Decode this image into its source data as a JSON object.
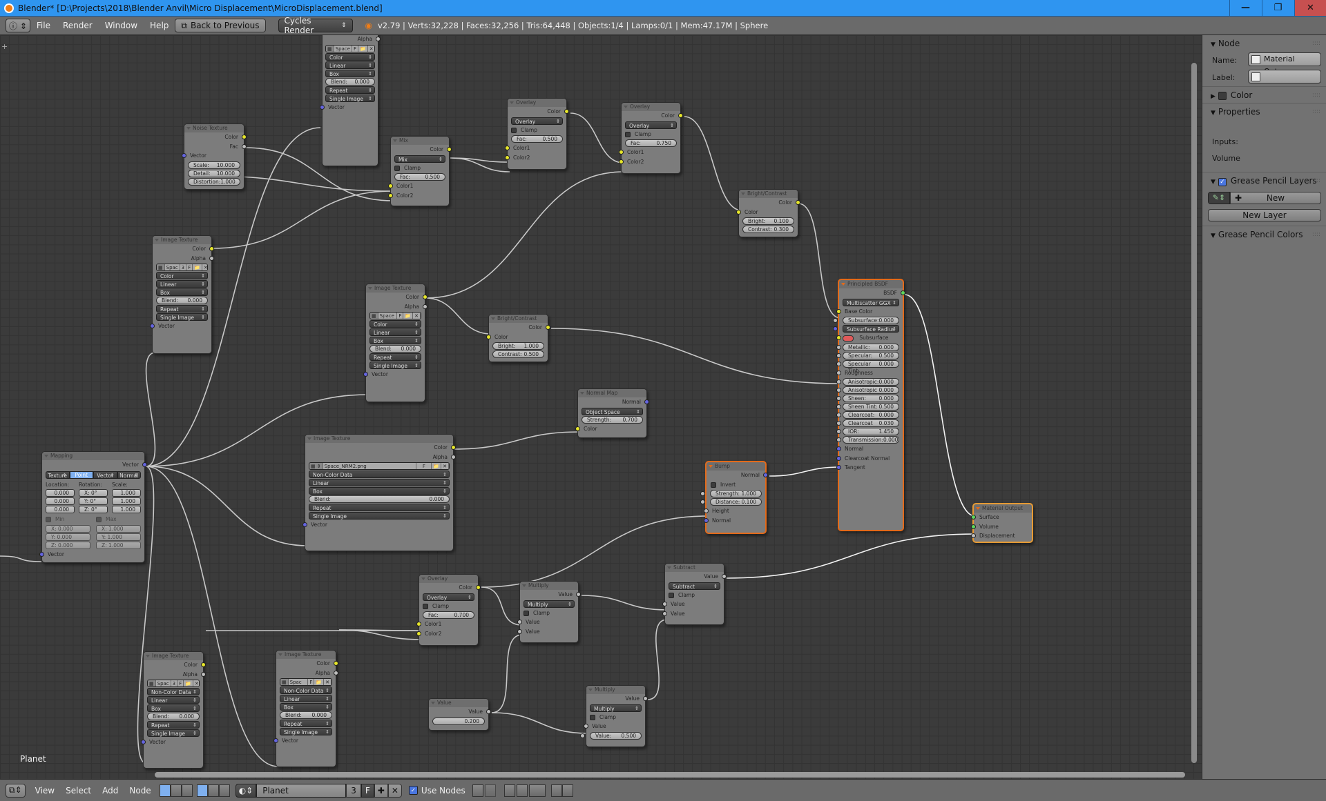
{
  "window": {
    "title": "Blender* [D:\\Projects\\2018\\Blender Anvil\\Micro Displacement\\MicroDisplacement.blend]",
    "minimize": "—",
    "restore": "❐",
    "close": "✕"
  },
  "menubar": {
    "items": [
      "File",
      "Render",
      "Window",
      "Help"
    ],
    "back_button": "Back to Previous",
    "render_engine": "Cycles Render",
    "stats": "v2.79 | Verts:32,228 | Faces:32,256 | Tris:64,448 | Objects:1/4 | Lamps:0/1 | Mem:47.17M | Sphere"
  },
  "canvas": {
    "material_label": "Planet"
  },
  "nodes": {
    "imgtex_top": {
      "alpha": "Alpha",
      "image": "Space",
      "f": "F",
      "colorspace": "Color",
      "interp": "Linear",
      "proj": "Box",
      "blend_label": "Blend:",
      "blend": "0.000",
      "ext": "Repeat",
      "source": "Single Image",
      "vector": "Vector"
    },
    "noise": {
      "title": "Noise Texture",
      "color": "Color",
      "fac": "Fac",
      "vector": "Vector",
      "scale_label": "Scale:",
      "scale": "10.000",
      "detail_label": "Detail:",
      "detail": "10.000",
      "distortion_label": "Distortion:",
      "distortion": "1.000"
    },
    "mix": {
      "title": "Mix",
      "color": "Color",
      "mode": "Mix",
      "clamp": "Clamp",
      "fac_label": "Fac:",
      "fac": "0.500",
      "c1": "Color1",
      "c2": "Color2"
    },
    "overlay1": {
      "title": "Overlay",
      "color": "Color",
      "mode": "Overlay",
      "clamp": "Clamp",
      "fac_label": "Fac:",
      "fac": "0.500",
      "c1": "Color1",
      "c2": "Color2"
    },
    "overlay2": {
      "title": "Overlay",
      "color": "Color",
      "mode": "Overlay",
      "clamp": "Clamp",
      "fac_label": "Fac:",
      "fac": "0.750",
      "c1": "Color1",
      "c2": "Color2"
    },
    "bc1": {
      "title": "Bright/Contrast",
      "color_out": "Color",
      "color_in": "Color",
      "bright_label": "Bright:",
      "bright": "0.100",
      "contrast_label": "Contrast:",
      "contrast": "0.300"
    },
    "imgtex_left": {
      "title": "Image Texture",
      "color": "Color",
      "alpha": "Alpha",
      "image": "Spac",
      "users": "3",
      "f": "F",
      "colorspace": "Color",
      "interp": "Linear",
      "proj": "Box",
      "blend_label": "Blend:",
      "blend": "0.000",
      "ext": "Repeat",
      "source": "Single Image",
      "vector": "Vector"
    },
    "imgtex_mid": {
      "title": "Image Texture",
      "color": "Color",
      "alpha": "Alpha",
      "image": "Space",
      "f": "F",
      "colorspace": "Color",
      "interp": "Linear",
      "proj": "Box",
      "blend_label": "Blend:",
      "blend": "0.000",
      "ext": "Repeat",
      "source": "Single Image",
      "vector": "Vector"
    },
    "bc2": {
      "title": "Bright/Contrast",
      "color_out": "Color",
      "color_in": "Color",
      "bright_label": "Bright:",
      "bright": "1.000",
      "contrast_label": "Contrast:",
      "contrast": "0.500"
    },
    "normalmap": {
      "title": "Normal Map",
      "normal": "Normal",
      "space": "Object Space",
      "strength_label": "Strength:",
      "strength": "0.700",
      "color": "Color"
    },
    "imgtex_nrm": {
      "title": "Image Texture",
      "color": "Color",
      "alpha": "Alpha",
      "image": "Space_NRM2.png",
      "f": "F",
      "colorspace": "Non-Color Data",
      "interp": "Linear",
      "proj": "Box",
      "blend_label": "Blend:",
      "blend": "0.000",
      "ext": "Repeat",
      "source": "Single Image",
      "vector": "Vector"
    },
    "mapping": {
      "title": "Mapping",
      "vector_out": "Vector",
      "tabs": [
        "Texture",
        "Point",
        "Vector",
        "Normal"
      ],
      "active_tab": "Point",
      "loc_label": "Location:",
      "rot_label": "Rotation:",
      "scale_label": "Scale:",
      "loc": [
        "0.000",
        "0.000",
        "0.000"
      ],
      "rot": [
        "X: 0°",
        "Y: 0°",
        "Z: 0°"
      ],
      "scale": [
        "1.000",
        "1.000",
        "1.000"
      ],
      "min": "Min",
      "max": "Max",
      "min_vals": [
        "X: 0.000",
        "Y: 0.000",
        "Z: 0.000"
      ],
      "max_vals": [
        "X: 1.000",
        "Y: 1.000",
        "Z: 1.000"
      ],
      "vector_in": "Vector"
    },
    "principled": {
      "title": "Principled BSDF",
      "bsdf": "BSDF",
      "dist": "Multiscatter GGX",
      "base_color": "Base Color",
      "subsurface": [
        "Subsurface:",
        "0.000"
      ],
      "ss_radius": "Subsurface Radius",
      "ss_color": "Subsurface Color",
      "ss_color_hex": "#e05a5a",
      "fields": [
        [
          "Metallic:",
          "0.000"
        ],
        [
          "Specular:",
          "0.500"
        ],
        [
          "Specular Tint:",
          "0.000"
        ]
      ],
      "roughness": "Roughness",
      "fields2": [
        [
          "Anisotropic:",
          "0.000"
        ],
        [
          "Anisotropic R:",
          "0.000"
        ],
        [
          "Sheen:",
          "0.000"
        ],
        [
          "Sheen Tint:",
          "0.500"
        ],
        [
          "Clearcoat:",
          "0.000"
        ],
        [
          "Clearcoat Ro:",
          "0.030"
        ],
        [
          "IOR:",
          "1.450"
        ],
        [
          "Transmission:",
          "0.000"
        ]
      ],
      "normal": "Normal",
      "cc_normal": "Clearcoat Normal",
      "tangent": "Tangent"
    },
    "bump": {
      "title": "Bump",
      "normal_out": "Normal",
      "invert": "Invert",
      "strength_label": "Strength:",
      "strength": "1.000",
      "distance_label": "Distance:",
      "distance": "0.100",
      "height": "Height",
      "normal_in": "Normal"
    },
    "output": {
      "title": "Material Output",
      "surface": "Surface",
      "volume": "Volume",
      "displacement": "Displacement"
    },
    "overlay3": {
      "title": "Overlay",
      "color": "Color",
      "mode": "Overlay",
      "clamp": "Clamp",
      "fac_label": "Fac:",
      "fac": "0.700",
      "c1": "Color1",
      "c2": "Color2"
    },
    "mult1": {
      "title": "Multiply",
      "value_out": "Value",
      "mode": "Multiply",
      "clamp": "Clamp",
      "v1": "Value",
      "v2": "Value"
    },
    "subtract": {
      "title": "Subtract",
      "value_out": "Value",
      "mode": "Subtract",
      "clamp": "Clamp",
      "v1": "Value",
      "v2": "Value"
    },
    "value": {
      "title": "Value",
      "value_out": "Value",
      "value": "0.200"
    },
    "mult2": {
      "title": "Multiply",
      "value_out": "Value",
      "mode": "Multiply",
      "clamp": "Clamp",
      "v1": "Value",
      "v2_label": "Value:",
      "v2": "0.500"
    },
    "imgtex_bl": {
      "title": "Image Texture",
      "color": "Color",
      "alpha": "Alpha",
      "image": "Spac",
      "users": "3",
      "f": "F",
      "colorspace": "Non-Color Data",
      "interp": "Linear",
      "proj": "Box",
      "blend_label": "Blend:",
      "blend": "0.000",
      "ext": "Repeat",
      "source": "Single Image",
      "vector": "Vector"
    },
    "imgtex_bm": {
      "title": "Image Texture",
      "color": "Color",
      "alpha": "Alpha",
      "image": "Spac",
      "f": "F",
      "colorspace": "Non-Color Data",
      "interp": "Linear",
      "proj": "Box",
      "blend_label": "Blend:",
      "blend": "0.000",
      "ext": "Repeat",
      "source": "Single Image",
      "vector": "Vector"
    }
  },
  "sidebar": {
    "node_panel": "Node",
    "name_label": "Name:",
    "name_value": "Material Outp...",
    "label_label": "Label:",
    "label_value": "",
    "color_panel": "Color",
    "properties_panel": "Properties",
    "inputs_label": "Inputs:",
    "volume_label": "Volume",
    "gp_layers_panel": "Grease Pencil Layers",
    "gp_new": "New",
    "gp_new_layer": "New Layer",
    "gp_colors_panel": "Grease Pencil Colors"
  },
  "statusbar": {
    "menus": [
      "View",
      "Select",
      "Add",
      "Node"
    ],
    "material": "Planet",
    "users": "3",
    "fake": "F",
    "use_nodes": "Use Nodes"
  }
}
